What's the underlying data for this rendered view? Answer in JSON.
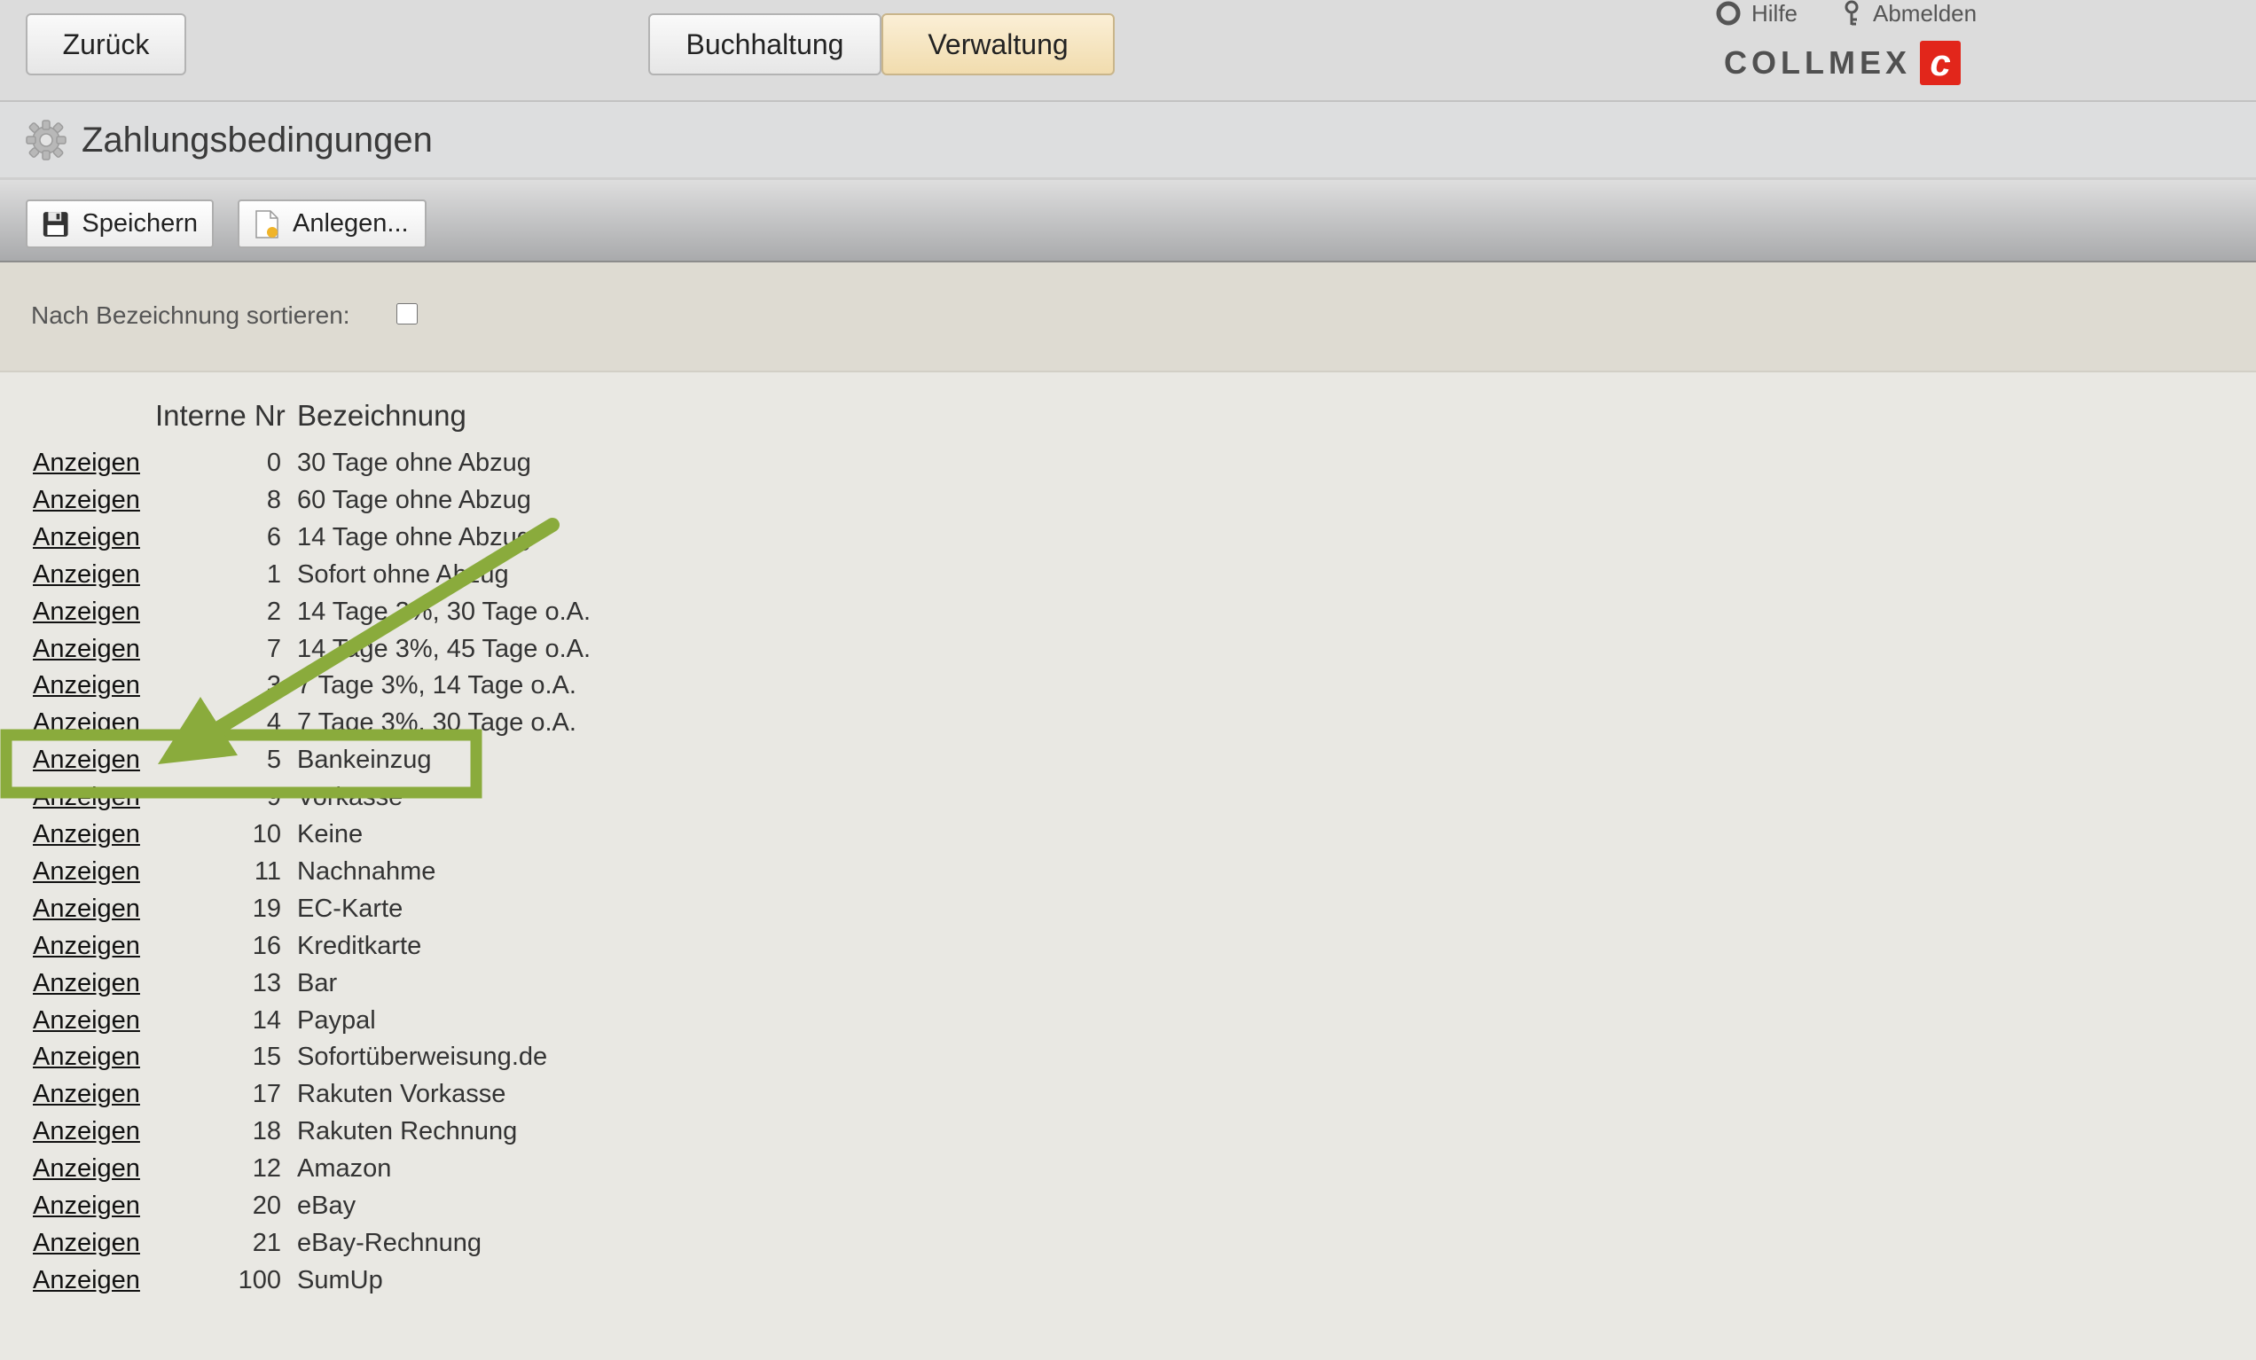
{
  "nav": {
    "back_label": "Zurück",
    "tabs": [
      {
        "label": "Buchhaltung",
        "active": false
      },
      {
        "label": "Verwaltung",
        "active": true
      }
    ],
    "help_label": "Hilfe",
    "logout_label": "Abmelden",
    "logo_text": "COLLMEX"
  },
  "page": {
    "title": "Zahlungsbedingungen",
    "icon": "gear-icon"
  },
  "toolbar": {
    "save_label": "Speichern",
    "create_label": "Anlegen..."
  },
  "filter": {
    "sort_label": "Nach Bezeichnung sortieren:",
    "sort_checked": false
  },
  "table": {
    "headers": [
      "Interne Nr",
      "Bezeichnung"
    ],
    "rows": [
      {
        "link": "Anzeigen",
        "nr": "0",
        "bez": "30 Tage ohne Abzug"
      },
      {
        "link": "Anzeigen",
        "nr": "8",
        "bez": "60 Tage ohne Abzug"
      },
      {
        "link": "Anzeigen",
        "nr": "6",
        "bez": "14 Tage ohne Abzug"
      },
      {
        "link": "Anzeigen",
        "nr": "1",
        "bez": "Sofort ohne Abzug"
      },
      {
        "link": "Anzeigen",
        "nr": "2",
        "bez": "14 Tage 2%, 30 Tage o.A."
      },
      {
        "link": "Anzeigen",
        "nr": "7",
        "bez": "14 Tage 3%, 45 Tage o.A."
      },
      {
        "link": "Anzeigen",
        "nr": "3",
        "bez": "7 Tage 3%, 14 Tage o.A."
      },
      {
        "link": "Anzeigen",
        "nr": "4",
        "bez": "7 Tage 3%, 30 Tage o.A."
      },
      {
        "link": "Anzeigen",
        "nr": "5",
        "bez": "Bankeinzug",
        "highlighted": true
      },
      {
        "link": "Anzeigen",
        "nr": "9",
        "bez": "Vorkasse"
      },
      {
        "link": "Anzeigen",
        "nr": "10",
        "bez": "Keine"
      },
      {
        "link": "Anzeigen",
        "nr": "11",
        "bez": "Nachnahme"
      },
      {
        "link": "Anzeigen",
        "nr": "19",
        "bez": "EC-Karte"
      },
      {
        "link": "Anzeigen",
        "nr": "16",
        "bez": "Kreditkarte"
      },
      {
        "link": "Anzeigen",
        "nr": "13",
        "bez": "Bar"
      },
      {
        "link": "Anzeigen",
        "nr": "14",
        "bez": "Paypal"
      },
      {
        "link": "Anzeigen",
        "nr": "15",
        "bez": "Sofortüberweisung.de"
      },
      {
        "link": "Anzeigen",
        "nr": "17",
        "bez": "Rakuten Vorkasse"
      },
      {
        "link": "Anzeigen",
        "nr": "18",
        "bez": "Rakuten Rechnung"
      },
      {
        "link": "Anzeigen",
        "nr": "12",
        "bez": "Amazon"
      },
      {
        "link": "Anzeigen",
        "nr": "20",
        "bez": "eBay"
      },
      {
        "link": "Anzeigen",
        "nr": "21",
        "bez": "eBay-Rechnung"
      },
      {
        "link": "Anzeigen",
        "nr": "100",
        "bez": "SumUp"
      }
    ]
  },
  "annotation": {
    "color": "#8aab3c",
    "highlighted_row": "Bankeinzug"
  },
  "colors": {
    "active_tab": "#f1dcae",
    "logo_red": "#e2261b"
  }
}
